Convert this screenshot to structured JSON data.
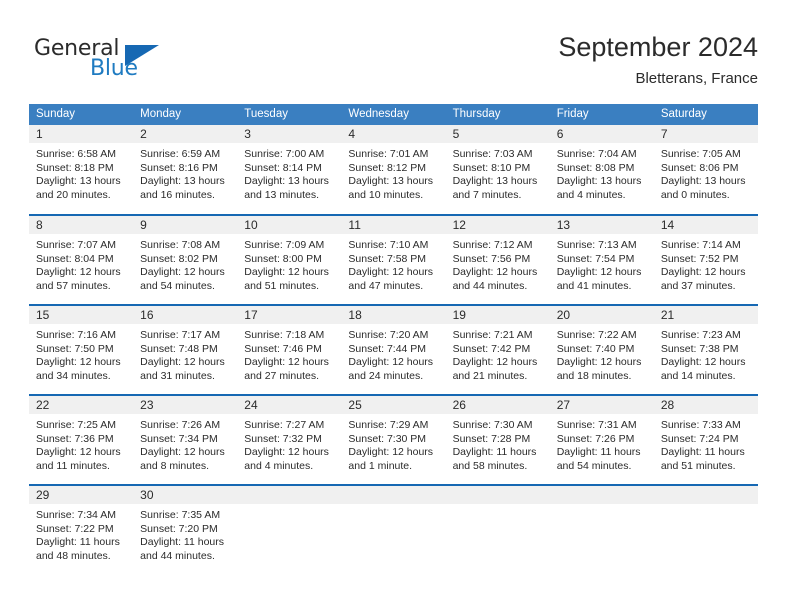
{
  "brand": {
    "name_top": "General",
    "name_bottom": "Blue",
    "triangle_icon": "blue-triangle-icon",
    "accent_color": "#1668b3"
  },
  "header": {
    "title": "September 2024",
    "subtitle": "Bletterans, France"
  },
  "calendar": {
    "header_bg": "#3a7fc1",
    "row_divider_color": "#1668b3",
    "daynum_bg": "#f0f0f0",
    "weekday_headers": [
      "Sunday",
      "Monday",
      "Tuesday",
      "Wednesday",
      "Thursday",
      "Friday",
      "Saturday"
    ],
    "weeks": [
      [
        {
          "day": "1",
          "sunrise": "Sunrise: 6:58 AM",
          "sunset": "Sunset: 8:18 PM",
          "daylight_1": "Daylight: 13 hours",
          "daylight_2": "and 20 minutes."
        },
        {
          "day": "2",
          "sunrise": "Sunrise: 6:59 AM",
          "sunset": "Sunset: 8:16 PM",
          "daylight_1": "Daylight: 13 hours",
          "daylight_2": "and 16 minutes."
        },
        {
          "day": "3",
          "sunrise": "Sunrise: 7:00 AM",
          "sunset": "Sunset: 8:14 PM",
          "daylight_1": "Daylight: 13 hours",
          "daylight_2": "and 13 minutes."
        },
        {
          "day": "4",
          "sunrise": "Sunrise: 7:01 AM",
          "sunset": "Sunset: 8:12 PM",
          "daylight_1": "Daylight: 13 hours",
          "daylight_2": "and 10 minutes."
        },
        {
          "day": "5",
          "sunrise": "Sunrise: 7:03 AM",
          "sunset": "Sunset: 8:10 PM",
          "daylight_1": "Daylight: 13 hours",
          "daylight_2": "and 7 minutes."
        },
        {
          "day": "6",
          "sunrise": "Sunrise: 7:04 AM",
          "sunset": "Sunset: 8:08 PM",
          "daylight_1": "Daylight: 13 hours",
          "daylight_2": "and 4 minutes."
        },
        {
          "day": "7",
          "sunrise": "Sunrise: 7:05 AM",
          "sunset": "Sunset: 8:06 PM",
          "daylight_1": "Daylight: 13 hours",
          "daylight_2": "and 0 minutes."
        }
      ],
      [
        {
          "day": "8",
          "sunrise": "Sunrise: 7:07 AM",
          "sunset": "Sunset: 8:04 PM",
          "daylight_1": "Daylight: 12 hours",
          "daylight_2": "and 57 minutes."
        },
        {
          "day": "9",
          "sunrise": "Sunrise: 7:08 AM",
          "sunset": "Sunset: 8:02 PM",
          "daylight_1": "Daylight: 12 hours",
          "daylight_2": "and 54 minutes."
        },
        {
          "day": "10",
          "sunrise": "Sunrise: 7:09 AM",
          "sunset": "Sunset: 8:00 PM",
          "daylight_1": "Daylight: 12 hours",
          "daylight_2": "and 51 minutes."
        },
        {
          "day": "11",
          "sunrise": "Sunrise: 7:10 AM",
          "sunset": "Sunset: 7:58 PM",
          "daylight_1": "Daylight: 12 hours",
          "daylight_2": "and 47 minutes."
        },
        {
          "day": "12",
          "sunrise": "Sunrise: 7:12 AM",
          "sunset": "Sunset: 7:56 PM",
          "daylight_1": "Daylight: 12 hours",
          "daylight_2": "and 44 minutes."
        },
        {
          "day": "13",
          "sunrise": "Sunrise: 7:13 AM",
          "sunset": "Sunset: 7:54 PM",
          "daylight_1": "Daylight: 12 hours",
          "daylight_2": "and 41 minutes."
        },
        {
          "day": "14",
          "sunrise": "Sunrise: 7:14 AM",
          "sunset": "Sunset: 7:52 PM",
          "daylight_1": "Daylight: 12 hours",
          "daylight_2": "and 37 minutes."
        }
      ],
      [
        {
          "day": "15",
          "sunrise": "Sunrise: 7:16 AM",
          "sunset": "Sunset: 7:50 PM",
          "daylight_1": "Daylight: 12 hours",
          "daylight_2": "and 34 minutes."
        },
        {
          "day": "16",
          "sunrise": "Sunrise: 7:17 AM",
          "sunset": "Sunset: 7:48 PM",
          "daylight_1": "Daylight: 12 hours",
          "daylight_2": "and 31 minutes."
        },
        {
          "day": "17",
          "sunrise": "Sunrise: 7:18 AM",
          "sunset": "Sunset: 7:46 PM",
          "daylight_1": "Daylight: 12 hours",
          "daylight_2": "and 27 minutes."
        },
        {
          "day": "18",
          "sunrise": "Sunrise: 7:20 AM",
          "sunset": "Sunset: 7:44 PM",
          "daylight_1": "Daylight: 12 hours",
          "daylight_2": "and 24 minutes."
        },
        {
          "day": "19",
          "sunrise": "Sunrise: 7:21 AM",
          "sunset": "Sunset: 7:42 PM",
          "daylight_1": "Daylight: 12 hours",
          "daylight_2": "and 21 minutes."
        },
        {
          "day": "20",
          "sunrise": "Sunrise: 7:22 AM",
          "sunset": "Sunset: 7:40 PM",
          "daylight_1": "Daylight: 12 hours",
          "daylight_2": "and 18 minutes."
        },
        {
          "day": "21",
          "sunrise": "Sunrise: 7:23 AM",
          "sunset": "Sunset: 7:38 PM",
          "daylight_1": "Daylight: 12 hours",
          "daylight_2": "and 14 minutes."
        }
      ],
      [
        {
          "day": "22",
          "sunrise": "Sunrise: 7:25 AM",
          "sunset": "Sunset: 7:36 PM",
          "daylight_1": "Daylight: 12 hours",
          "daylight_2": "and 11 minutes."
        },
        {
          "day": "23",
          "sunrise": "Sunrise: 7:26 AM",
          "sunset": "Sunset: 7:34 PM",
          "daylight_1": "Daylight: 12 hours",
          "daylight_2": "and 8 minutes."
        },
        {
          "day": "24",
          "sunrise": "Sunrise: 7:27 AM",
          "sunset": "Sunset: 7:32 PM",
          "daylight_1": "Daylight: 12 hours",
          "daylight_2": "and 4 minutes."
        },
        {
          "day": "25",
          "sunrise": "Sunrise: 7:29 AM",
          "sunset": "Sunset: 7:30 PM",
          "daylight_1": "Daylight: 12 hours",
          "daylight_2": "and 1 minute."
        },
        {
          "day": "26",
          "sunrise": "Sunrise: 7:30 AM",
          "sunset": "Sunset: 7:28 PM",
          "daylight_1": "Daylight: 11 hours",
          "daylight_2": "and 58 minutes."
        },
        {
          "day": "27",
          "sunrise": "Sunrise: 7:31 AM",
          "sunset": "Sunset: 7:26 PM",
          "daylight_1": "Daylight: 11 hours",
          "daylight_2": "and 54 minutes."
        },
        {
          "day": "28",
          "sunrise": "Sunrise: 7:33 AM",
          "sunset": "Sunset: 7:24 PM",
          "daylight_1": "Daylight: 11 hours",
          "daylight_2": "and 51 minutes."
        }
      ],
      [
        {
          "day": "29",
          "sunrise": "Sunrise: 7:34 AM",
          "sunset": "Sunset: 7:22 PM",
          "daylight_1": "Daylight: 11 hours",
          "daylight_2": "and 48 minutes."
        },
        {
          "day": "30",
          "sunrise": "Sunrise: 7:35 AM",
          "sunset": "Sunset: 7:20 PM",
          "daylight_1": "Daylight: 11 hours",
          "daylight_2": "and 44 minutes."
        },
        {
          "day": "",
          "sunrise": "",
          "sunset": "",
          "daylight_1": "",
          "daylight_2": ""
        },
        {
          "day": "",
          "sunrise": "",
          "sunset": "",
          "daylight_1": "",
          "daylight_2": ""
        },
        {
          "day": "",
          "sunrise": "",
          "sunset": "",
          "daylight_1": "",
          "daylight_2": ""
        },
        {
          "day": "",
          "sunrise": "",
          "sunset": "",
          "daylight_1": "",
          "daylight_2": ""
        },
        {
          "day": "",
          "sunrise": "",
          "sunset": "",
          "daylight_1": "",
          "daylight_2": ""
        }
      ]
    ]
  }
}
